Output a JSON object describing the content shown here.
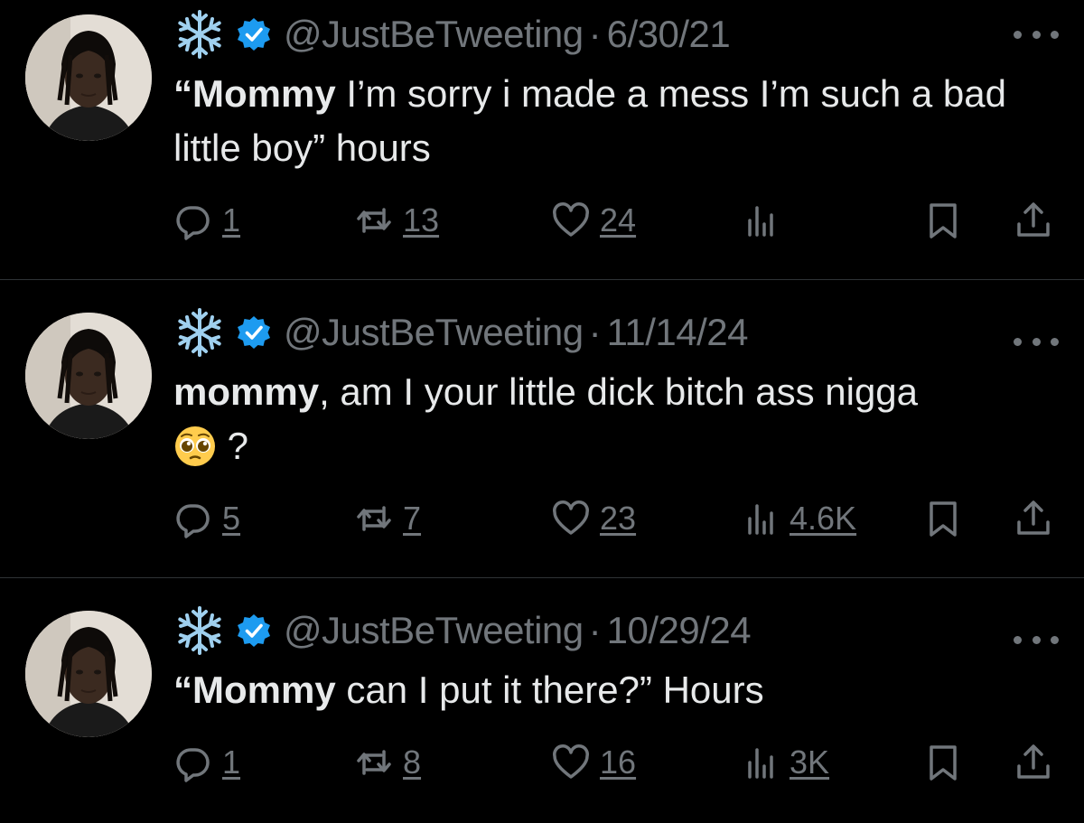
{
  "tweets": [
    {
      "handle": "@JustBeTweeting",
      "dot": "·",
      "date": "6/30/21",
      "bold": "“Mommy",
      "text": " I’m sorry i made a mess I’m such a bad little boy” hours",
      "replies": "1",
      "retweets": "13",
      "likes": "24",
      "views": ""
    },
    {
      "handle": "@JustBeTweeting",
      "dot": "·",
      "date": "11/14/24",
      "bold": "mommy",
      "text": ", am I your little dick bitch ass nigga",
      "text_after_emoji": " ?",
      "emoji": "pleading-face",
      "replies": "5",
      "retweets": "7",
      "likes": "23",
      "views": "4.6K"
    },
    {
      "handle": "@JustBeTweeting",
      "dot": "·",
      "date": "10/29/24",
      "bold": "“Mommy",
      "text": " can I put it there?” Hours",
      "replies": "1",
      "retweets": "8",
      "likes": "16",
      "views": "3K"
    }
  ],
  "icons": {
    "name_emoji": "snowflake-icon",
    "badge": "verified-badge-icon",
    "reply": "reply-icon",
    "retweet": "retweet-icon",
    "like": "heart-icon",
    "views": "views-icon",
    "bookmark": "bookmark-icon",
    "share": "share-icon",
    "more": "more-icon"
  },
  "colors": {
    "background": "#000000",
    "text": "#e7e9ea",
    "muted": "#71767b",
    "verified": "#1d9bf0",
    "divider": "#2f3336"
  }
}
